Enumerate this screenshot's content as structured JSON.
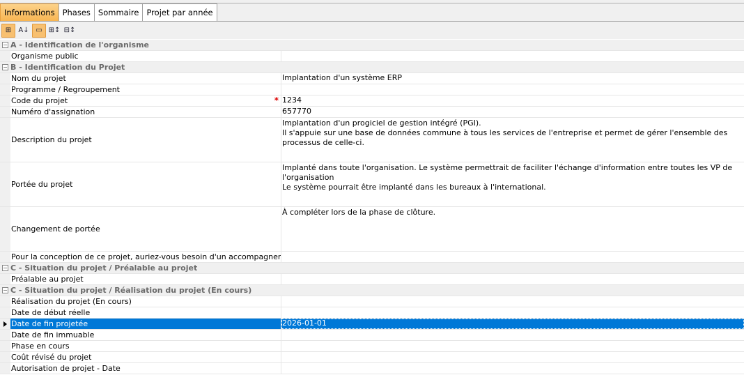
{
  "tabs": [
    {
      "label": "Informations",
      "active": true
    },
    {
      "label": "Phases"
    },
    {
      "label": "Sommaire"
    },
    {
      "label": "Projet par année"
    }
  ],
  "toolbar": [
    {
      "icon": "categorized-icon",
      "active": true,
      "glyph": "⊞"
    },
    {
      "icon": "sort-alphabetical-icon",
      "glyph": "A↓"
    },
    {
      "icon": "property-pages-icon",
      "active": true,
      "glyph": "▭"
    },
    {
      "icon": "expand-all-icon",
      "glyph": "⊞↕"
    },
    {
      "icon": "collapse-all-icon",
      "glyph": "⊟↕"
    }
  ],
  "accent": "#0078d7",
  "rows": [
    {
      "type": "group",
      "label": "A - Identification de l'organisme"
    },
    {
      "label": "Organisme public",
      "value": ""
    },
    {
      "type": "group",
      "label": "B - Identification du Projet"
    },
    {
      "label": "Nom du projet",
      "value": "Implantation d'un système ERP"
    },
    {
      "label": "Programme / Regroupement",
      "value": ""
    },
    {
      "label": "Code du projet",
      "value": "1234",
      "required": "*"
    },
    {
      "label": "Numéro d'assignation",
      "value": "657770"
    },
    {
      "label": "Description du projet",
      "value": "Implantation d'un progiciel de gestion intégré (PGI).\nIl s'appuie sur une base de données commune à tous les services de l'entreprise et permet de gérer l'ensemble des processus de celle-ci.",
      "tall": true
    },
    {
      "label": "Portée du projet",
      "value": "Implanté dans toute l'organisation. Le système permettrait de faciliter l'échange d'information entre toutes les VP de l'organisation\nLe système pourrait être implanté dans les bureaux à l'international.",
      "tall": true
    },
    {
      "label": "Changement de portée",
      "value": "À compléter lors de la phase de clôture.",
      "tall": true
    },
    {
      "label": "Pour la conception de ce projet, auriez-vous besoin d'un accompagnement du...",
      "value": ""
    },
    {
      "type": "group",
      "label": "C - Situation du projet / Préalable au projet"
    },
    {
      "label": "Préalable au projet",
      "value": ""
    },
    {
      "type": "group",
      "label": "C - Situation du projet / Réalisation du projet (En cours)"
    },
    {
      "label": "Réalisation du projet (En cours)",
      "value": ""
    },
    {
      "label": "Date de début réelle",
      "value": ""
    },
    {
      "label": "Date de fin projetée",
      "value": "2026-01-01",
      "selected": true
    },
    {
      "label": "Date de fin immuable",
      "value": ""
    },
    {
      "label": "Phase en cours",
      "value": ""
    },
    {
      "label": "Coût révisé du projet",
      "value": ""
    },
    {
      "label": "Autorisation de projet - Date",
      "value": ""
    }
  ]
}
